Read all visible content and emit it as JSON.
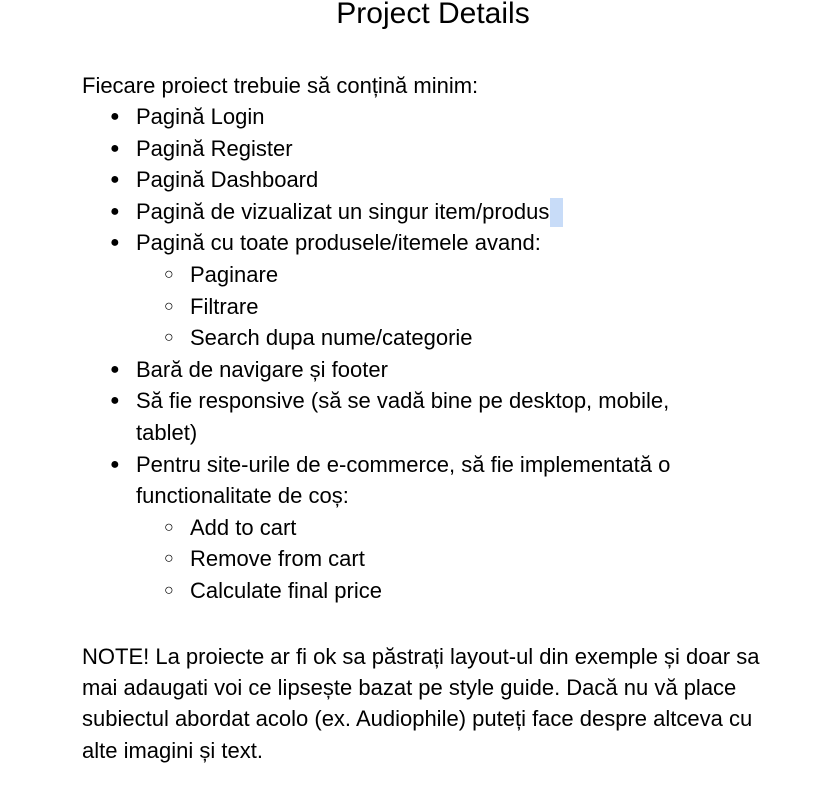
{
  "document": {
    "title": "Project Details",
    "intro": "Fiecare proiect trebuie să conțină minim:",
    "requirements": [
      "Pagină Login",
      "Pagină Register",
      "Pagină Dashboard",
      "Pagină de vizualizat un singur item/produs",
      "Pagină cu toate produsele/itemele avand:",
      "Bară de navigare și footer",
      "Să fie responsive (să se vadă bine pe desktop, mobile, tablet)",
      "Pentru site-urile de e-commerce, să fie implementată o functionalitate de coș:"
    ],
    "products_page_features": [
      "Paginare",
      "Filtrare",
      "Search dupa nume/categorie"
    ],
    "cart_features": [
      "Add to cart",
      "Remove from cart",
      "Calculate final price"
    ],
    "note": "NOTE! La proiecte ar fi ok sa păstrați layout-ul din exemple și doar sa mai adaugati voi ce lipsește bazat pe style guide. Dacă nu vă place subiectul abordat acolo (ex. Audiophile) puteți face despre altceva cu alte imagini și text.",
    "bullet_glyph": "●",
    "sub_bullet_glyph": "○",
    "selection_color": "#c8dcf8"
  }
}
